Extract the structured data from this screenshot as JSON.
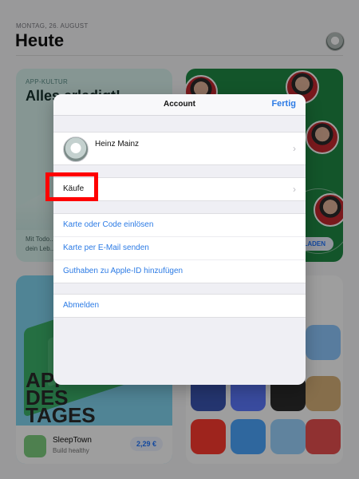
{
  "background": {
    "date": "MONTAG, 26. AUGUST",
    "page_title": "Heute",
    "card_kultur": {
      "kicker": "APP-KULTUR",
      "title": "Alles erledigt!",
      "footer_line1": "Mit Todo...",
      "footer_line2": "dein Leb..."
    },
    "card_sport": {
      "button": "LADEN"
    },
    "card_tag": {
      "headline_line1": "APP",
      "headline_line2": "DES",
      "headline_line3": "TAGES",
      "app_name": "SleepTown",
      "app_subtitle": "Build healthy",
      "price": "2,29 €"
    }
  },
  "modal": {
    "title": "Account",
    "done": "Fertig",
    "profile": {
      "name": "Heinz Mainz"
    },
    "purchases": "Käufe",
    "actions": [
      "Karte oder Code einlösen",
      "Karte per E-Mail senden",
      "Guthaben zu Apple-ID hinzufügen"
    ],
    "sign_out": "Abmelden"
  },
  "colors": {
    "accent_blue": "#2c7be5",
    "highlight_red": "#ff0000"
  },
  "icons": {
    "chevron": "chevron-right-icon",
    "avatar": "avatar-icon"
  }
}
